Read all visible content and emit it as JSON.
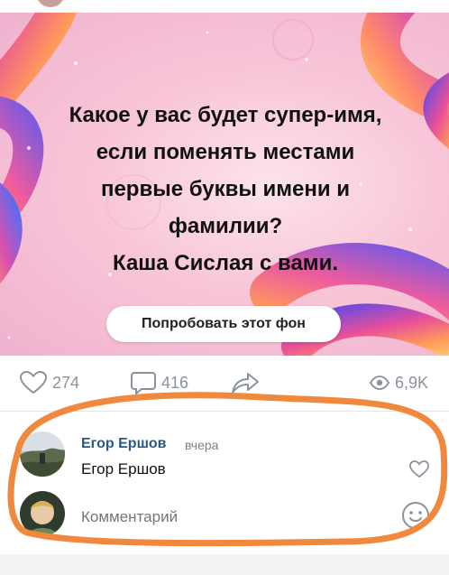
{
  "post": {
    "card_lines": [
      "Какое у вас будет супер-имя,",
      "если поменять местами",
      "первые буквы имени и",
      "фамилии?",
      "Каша Сислая с вами."
    ],
    "try_background_label": "Попробовать этот фон"
  },
  "actions": {
    "likes": "274",
    "comments": "416",
    "views": "6,9K"
  },
  "comment": {
    "author": "Егор Ершов",
    "time": "вчера",
    "text": "Егор Ершов"
  },
  "composer": {
    "placeholder": "Комментарий"
  },
  "colors": {
    "link": "#2a5885",
    "icon_gray": "#8a929c",
    "annotation": "#f0883e"
  }
}
